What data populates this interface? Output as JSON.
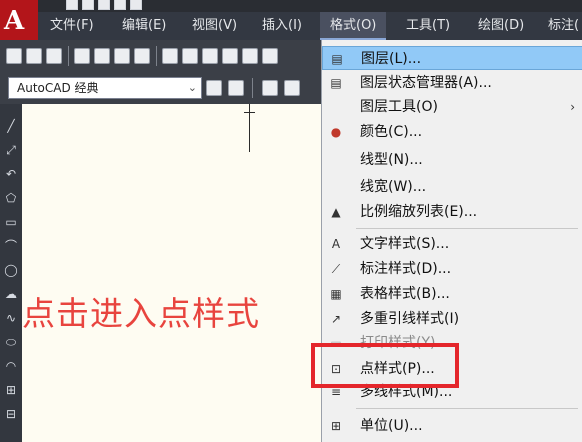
{
  "menubar": {
    "items": [
      "文件(F)",
      "编辑(E)",
      "视图(V)",
      "插入(I)",
      "格式(O)",
      "工具(T)",
      "绘图(D)",
      "标注("
    ]
  },
  "toolbar": {
    "workspace": "AutoCAD 经典"
  },
  "format_menu": {
    "items": [
      {
        "label": "图层(L)...",
        "icon": "layers-icon",
        "highlighted": true
      },
      {
        "label": "图层状态管理器(A)...",
        "icon": "layer-state-icon"
      },
      {
        "label": "图层工具(O)",
        "icon": "",
        "submenu_arrow": "›"
      },
      {
        "label": "颜色(C)...",
        "icon": "color-wheel-icon"
      },
      {
        "label": "线型(N)...",
        "icon": ""
      },
      {
        "label": "线宽(W)...",
        "icon": ""
      },
      {
        "label": "比例缩放列表(E)...",
        "icon": "scale-list-icon"
      },
      {
        "label": "文字样式(S)...",
        "icon": "text-style-icon"
      },
      {
        "label": "标注样式(D)...",
        "icon": "dim-style-icon"
      },
      {
        "label": "表格样式(B)...",
        "icon": "table-style-icon"
      },
      {
        "label": "多重引线样式(I)",
        "icon": "mleader-style-icon"
      },
      {
        "label": "打印样式(Y)...",
        "icon": "plot-style-icon",
        "disabled": true
      },
      {
        "label": "点样式(P)...",
        "icon": "point-style-icon"
      },
      {
        "label": "多线样式(M)...",
        "icon": "mline-style-icon"
      },
      {
        "label": "单位(U)...",
        "icon": "units-icon"
      }
    ]
  },
  "canvas": {
    "caption": "点击进入点样式"
  },
  "colors": {
    "caption": "#e8443e",
    "highlight_box": "#e4262b",
    "menu_highlight": "#91c9f7"
  }
}
